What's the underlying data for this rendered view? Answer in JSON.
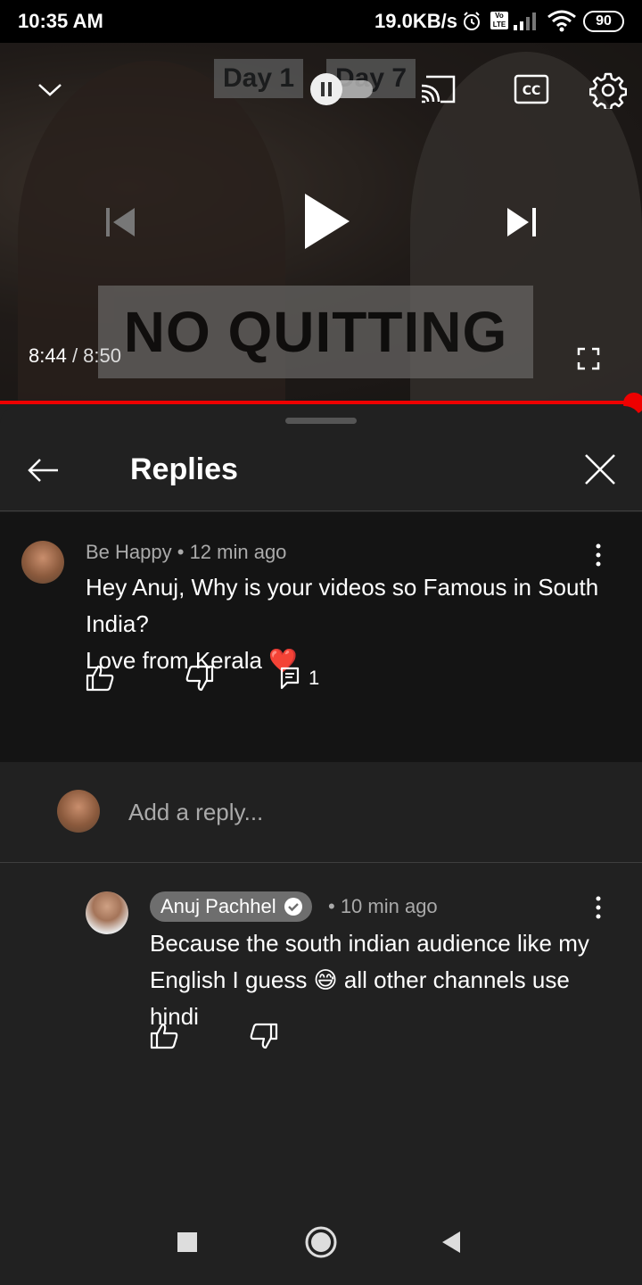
{
  "status_bar": {
    "time": "10:35 AM",
    "network_speed": "19.0KB/s",
    "volte_label": "Vo LTE",
    "battery": "90"
  },
  "player": {
    "thumbnail_text": {
      "day1": "Day 1",
      "day7": "Day 7",
      "banner": "NO QUITTING"
    },
    "current_time": "8:44",
    "separator": " / ",
    "total_time": "8:50",
    "progress_fraction": 0.988,
    "accent_color": "#ee0000"
  },
  "panel": {
    "title": "Replies"
  },
  "comment": {
    "author": "Be Happy",
    "meta_separator": " • ",
    "age": "12 min ago",
    "text_line1": "Hey Anuj, Why is your videos so Famous in South India?",
    "text_line2": "Love from Kerala ❤️",
    "reply_count": "1"
  },
  "add_reply": {
    "placeholder": "Add a reply..."
  },
  "reply": {
    "author": "Anuj Pachhel",
    "meta": "• 10 min ago",
    "text": "Because the south indian audience like my English I guess 😅 all other channels use hindi"
  },
  "icons": {
    "collapse": "chevron-down-icon",
    "cast": "cast-icon",
    "captions": "cc-icon",
    "settings": "gear-icon",
    "previous": "skip-previous-icon",
    "play": "play-icon",
    "next": "skip-next-icon",
    "fullscreen": "fullscreen-icon",
    "back": "arrow-left-icon",
    "close": "close-icon",
    "more": "more-vert-icon",
    "like": "thumb-up-icon",
    "dislike": "thumb-down-icon",
    "replies": "comment-icon",
    "verified": "verified-check-icon"
  }
}
